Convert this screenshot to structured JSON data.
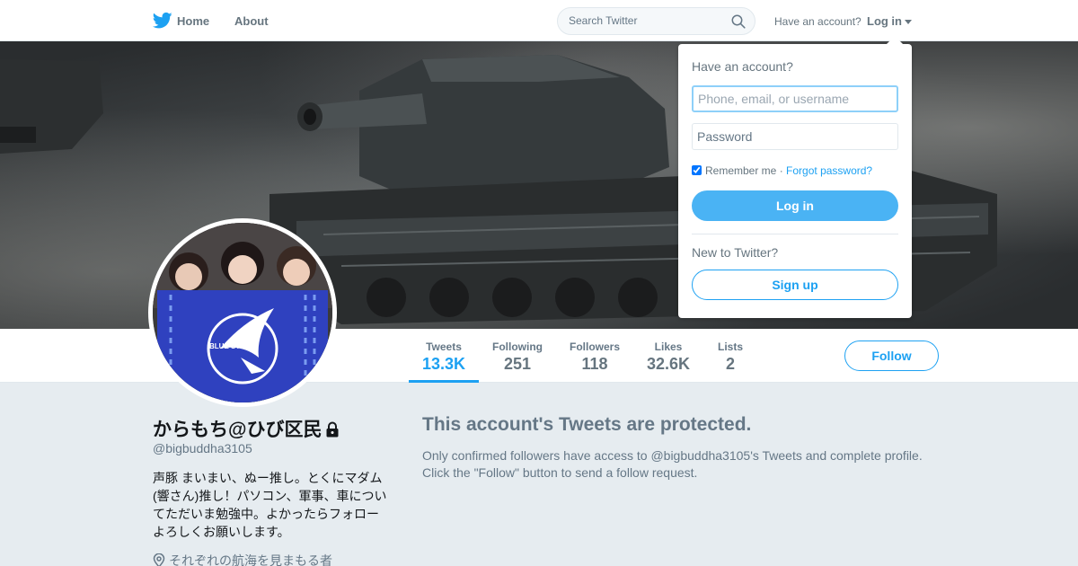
{
  "nav": {
    "home": "Home",
    "about": "About",
    "search_placeholder": "Search Twitter",
    "have_account": "Have an account?",
    "login": "Log in"
  },
  "profile": {
    "name": "からもち@ひび区民",
    "handle": "@bigbuddha3105",
    "bio": "声豚 まいまい、ぬー推し。とくにマダム(響さん)推し！パソコン、軍事、車についてただいま勉強中。よかったらフォローよろしくお願いします。",
    "location": "それぞれの航海を見まもる者",
    "avatar_flag_text": "BLUE STEEL"
  },
  "stats": [
    {
      "label": "Tweets",
      "value": "13.3K",
      "active": true
    },
    {
      "label": "Following",
      "value": "251"
    },
    {
      "label": "Followers",
      "value": "118"
    },
    {
      "label": "Likes",
      "value": "32.6K"
    },
    {
      "label": "Lists",
      "value": "2"
    }
  ],
  "follow_label": "Follow",
  "protected": {
    "title": "This account's Tweets are protected.",
    "text": "Only confirmed followers have access to @bigbuddha3105's Tweets and complete profile. Click the \"Follow\" button to send a follow request."
  },
  "login_dropdown": {
    "title": "Have an account?",
    "username_placeholder": "Phone, email, or username",
    "password_placeholder": "Password",
    "remember": "Remember me",
    "separator": "·",
    "forgot": "Forgot password?",
    "login_button": "Log in",
    "new_to_twitter": "New to Twitter?",
    "signup_button": "Sign up"
  },
  "colors": {
    "accent": "#1da1f2",
    "login_button": "#4ab3f4",
    "background": "#e6ecf0"
  },
  "icons": [
    "twitter-bird-icon",
    "search-icon",
    "lock-icon",
    "location-pin-icon",
    "caret-down-icon"
  ]
}
